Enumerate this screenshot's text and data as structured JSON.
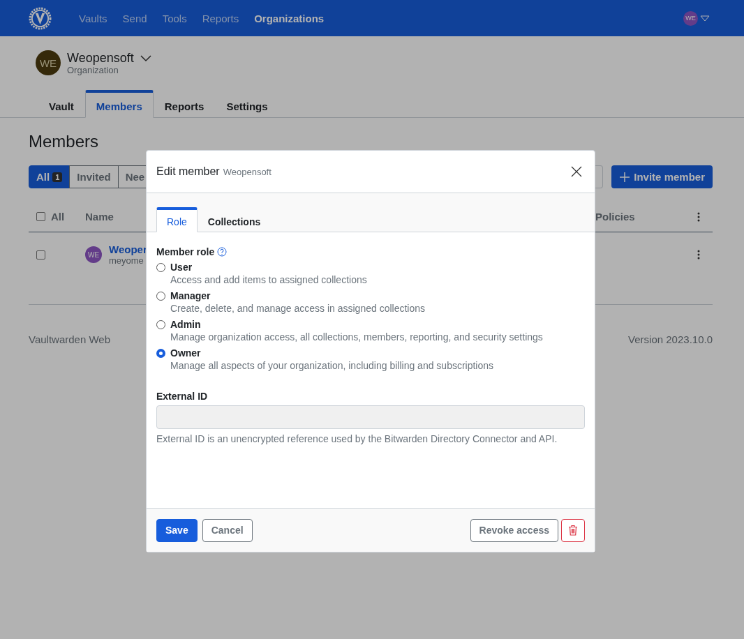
{
  "nav": {
    "links": [
      {
        "label": "Vaults",
        "selected": false
      },
      {
        "label": "Send",
        "selected": false
      },
      {
        "label": "Tools",
        "selected": false
      },
      {
        "label": "Reports",
        "selected": false
      },
      {
        "label": "Organizations",
        "selected": true
      }
    ],
    "user_initials": "WE"
  },
  "organization": {
    "initials": "WE",
    "name": "Weopensoft",
    "type": "Organization"
  },
  "org_tabs": [
    {
      "label": "Vault",
      "selected": false
    },
    {
      "label": "Members",
      "selected": true
    },
    {
      "label": "Reports",
      "selected": false
    },
    {
      "label": "Settings",
      "selected": false
    }
  ],
  "page_title": "Members",
  "filters": [
    {
      "label": "All",
      "count": "1",
      "selected": true
    },
    {
      "label": "Invited",
      "selected": false
    },
    {
      "label": "Nee",
      "selected": false
    }
  ],
  "invite_button": "Invite member",
  "table": {
    "select_all": {
      "label": "All",
      "checked": false
    },
    "columns": [
      "Name",
      "Policies"
    ],
    "rows": [
      {
        "checked": false,
        "initials": "WE",
        "name": "Weoper",
        "email": "meyome"
      }
    ]
  },
  "footer": {
    "app": "Vaultwarden Web",
    "version": "Version 2023.10.0"
  },
  "dialog": {
    "title": "Edit member",
    "subtitle": "Weopensoft",
    "tabs": [
      {
        "label": "Role",
        "selected": true
      },
      {
        "label": "Collections",
        "selected": false
      }
    ],
    "role_label": "Member role",
    "roles": [
      {
        "label": "User",
        "description": "Access and add items to assigned collections",
        "selected": false
      },
      {
        "label": "Manager",
        "description": "Create, delete, and manage access in assigned collections",
        "selected": false
      },
      {
        "label": "Admin",
        "description": "Manage organization access, all collections, members, reporting, and security settings",
        "selected": false
      },
      {
        "label": "Owner",
        "description": "Manage all aspects of your organization, including billing and subscriptions",
        "selected": true
      }
    ],
    "external_id": {
      "label": "External ID",
      "disabled": true,
      "help": "External ID is an unencrypted reference used by the Bitwarden Directory Connector and API."
    },
    "buttons": {
      "save": "Save",
      "cancel": "Cancel",
      "revoke": "Revoke access"
    }
  }
}
